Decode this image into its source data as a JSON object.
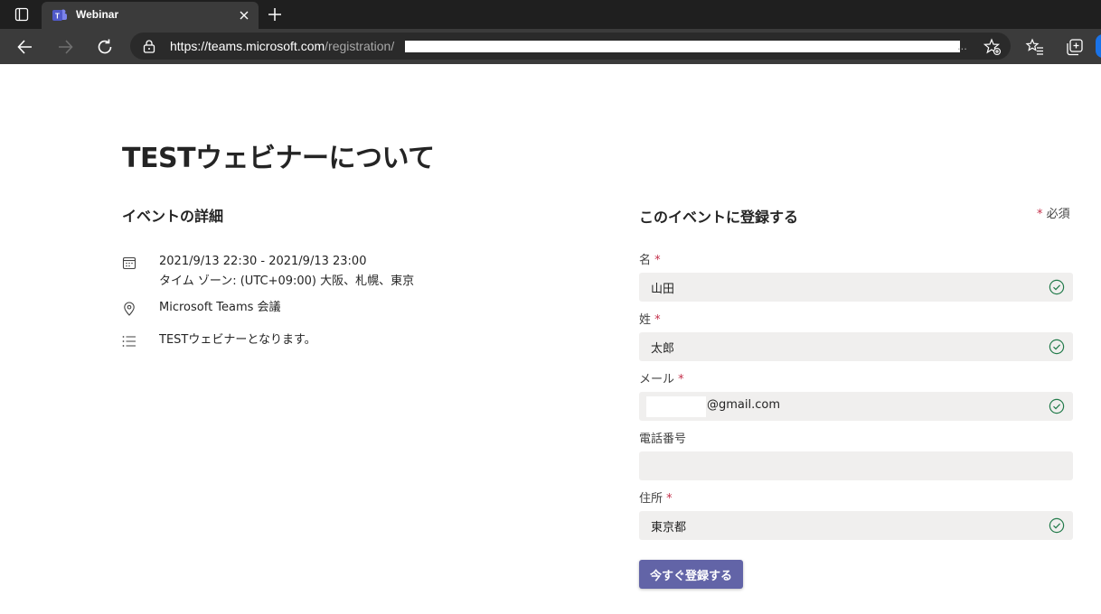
{
  "browser": {
    "tab_title": "Webinar",
    "url_host": "https://teams.microsoft.com",
    "url_path": "/registration/",
    "url_ellipsis": "..."
  },
  "page": {
    "title": "TESTウェビナーについて",
    "details_heading": "イベントの詳細",
    "datetime": "2021/9/13 22:30 - 2021/9/13 23:00",
    "timezone": "タイム ゾーン: (UTC+09:00) 大阪、札幌、東京",
    "location": "Microsoft Teams 会議",
    "description": "TESTウェビナーとなります。"
  },
  "form": {
    "heading": "このイベントに登録する",
    "required_mark": "*",
    "required_label": "必須",
    "fields": [
      {
        "label": "名",
        "required": true,
        "value": "山田",
        "valid": true
      },
      {
        "label": "姓",
        "required": true,
        "value": "太郎",
        "valid": true
      },
      {
        "label": "メール",
        "required": true,
        "value": "@gmail.com",
        "valid": true
      },
      {
        "label": "電話番号",
        "required": false,
        "value": "",
        "valid": false
      },
      {
        "label": "住所",
        "required": true,
        "value": "東京都",
        "valid": true
      }
    ],
    "submit_label": "今すぐ登録する"
  },
  "colors": {
    "accent": "#6264a7",
    "required": "#c4314b",
    "valid_check": "#237b4b",
    "field_bg": "#f0efee"
  }
}
